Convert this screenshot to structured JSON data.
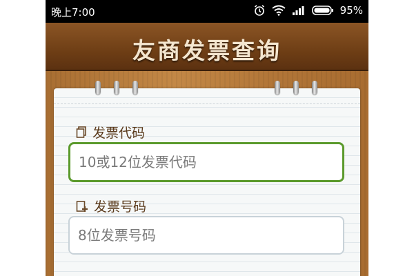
{
  "status_bar": {
    "time": "晚上7:00",
    "battery_percent": "95%",
    "icons": [
      "alarm-icon",
      "wifi-icon",
      "signal-icon",
      "battery-icon"
    ]
  },
  "header": {
    "title": "友商发票查询"
  },
  "form": {
    "invoice_code": {
      "label": "发票代码",
      "icon": "document-icon",
      "placeholder": "10或12位发票代码"
    },
    "invoice_number": {
      "label": "发票号码",
      "icon": "document-add-icon",
      "placeholder": "8位发票号码"
    }
  },
  "colors": {
    "header_brown": "#6e3e15",
    "active_border": "#5b9a2c",
    "label_brown": "#5a3a1c"
  }
}
